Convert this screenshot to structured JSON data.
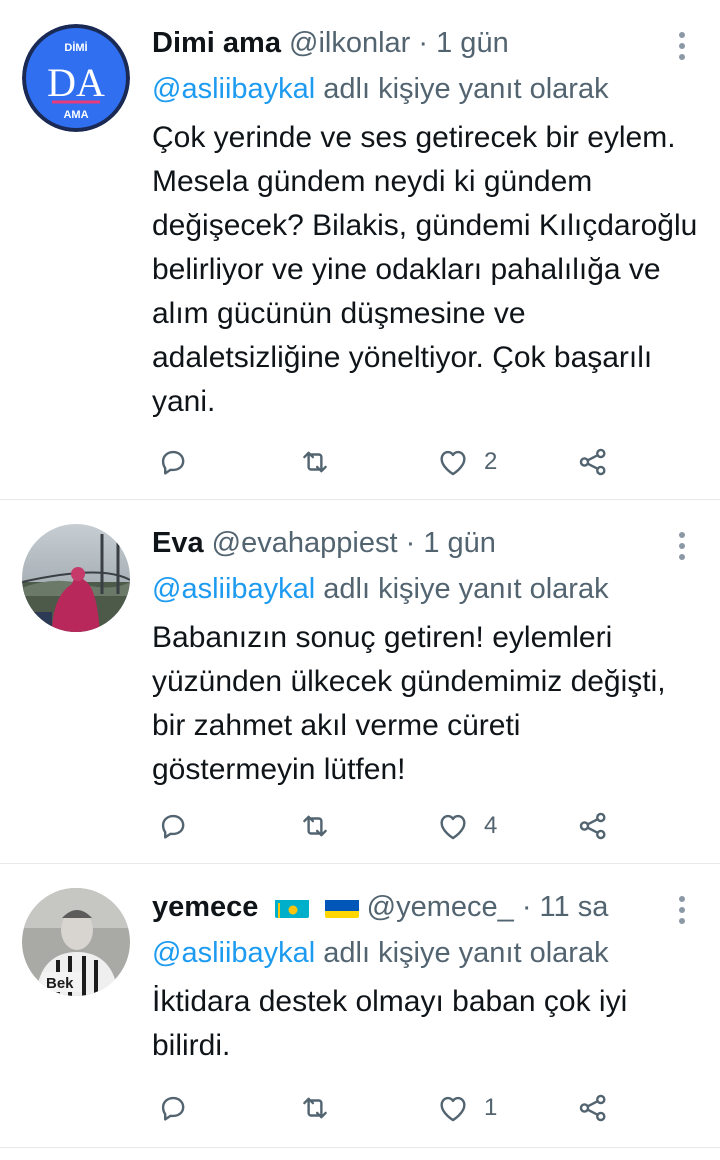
{
  "tweets": [
    {
      "name": "Dimi ama",
      "handle": "@ilkonlar",
      "dot": "·",
      "time": "1 gün",
      "reply_to": "@asliibaykal",
      "reply_suffix": "adlı kişiye yanıt olarak",
      "text": "Çok yerinde ve ses getirecek bir eylem. Mesela gündem neydi ki gündem değişecek? Bilakis, gündemi Kılıçdaroğlu belirliyor ve yine odakları pahalılığa ve alım gücünün düşmesine ve adaletsizliğine yöneltiyor. Çok başarılı yani.",
      "avatar": {
        "top_text": "DİMİ",
        "initials": "DA",
        "bottom_text": "AMA",
        "bg": "#2f6ff0",
        "ring": "#1a2a55"
      },
      "likes": "2"
    },
    {
      "name": "Eva",
      "handle": "@evahappiest",
      "dot": "·",
      "time": "1 gün",
      "reply_to": "@asliibaykal",
      "reply_suffix": "adlı kişiye yanıt olarak",
      "text": "Babanızın sonuç getiren! eylemleri yüzünden ülkecek gündemimiz değişti, bir zahmet akıl verme cüreti göstermeyin lütfen!",
      "likes": "4"
    },
    {
      "name": "yemece",
      "handle": "@yemece_",
      "dot": "·",
      "time": "11 sa",
      "reply_to": "@asliibaykal",
      "reply_suffix": "adlı kişiye yanıt olarak",
      "text": "İktidara destek olmayı baban çok iyi bilirdi.",
      "avatar_caption": "Bek",
      "flags": [
        "kazakhstan-flag",
        "ukraine-flag"
      ],
      "likes": "1"
    }
  ],
  "icons": {
    "reply": "reply-icon",
    "retweet": "retweet-icon",
    "like": "heart-icon",
    "share": "share-icon",
    "more": "more-vertical-icon"
  },
  "colors": {
    "mention": "#1d9bf0",
    "secondary_text": "#536471",
    "primary_text": "#0f1419"
  }
}
